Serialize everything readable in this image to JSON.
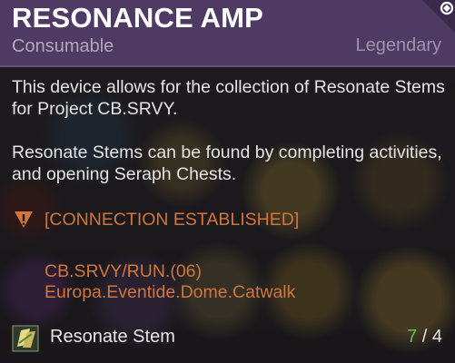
{
  "item": {
    "name": "RESONANCE AMP",
    "type": "Consumable",
    "rarity": "Legendary",
    "header_color": "#4f3a63"
  },
  "description": {
    "paragraph1": "This device allows for the collection of Resonate Stems for Project CB.SRVY.",
    "paragraph2": "Resonate Stems can be found by completing activities, and opening Seraph Chests."
  },
  "lore": {
    "status": "[CONNECTION ESTABLISHED]",
    "line2": "CB.SRVY/RUN.(06)",
    "line3": "Europa.Eventide.Dome.Catwalk",
    "color": "#d2753a",
    "icon": "warning-triangle-icon"
  },
  "requirement": {
    "icon": "resonate-stem-icon",
    "label": "Resonate Stem",
    "have": "7",
    "separator": " / ",
    "need": "4",
    "have_color": "#5fbf5a"
  },
  "corner_icon": "faction-emblem-icon"
}
